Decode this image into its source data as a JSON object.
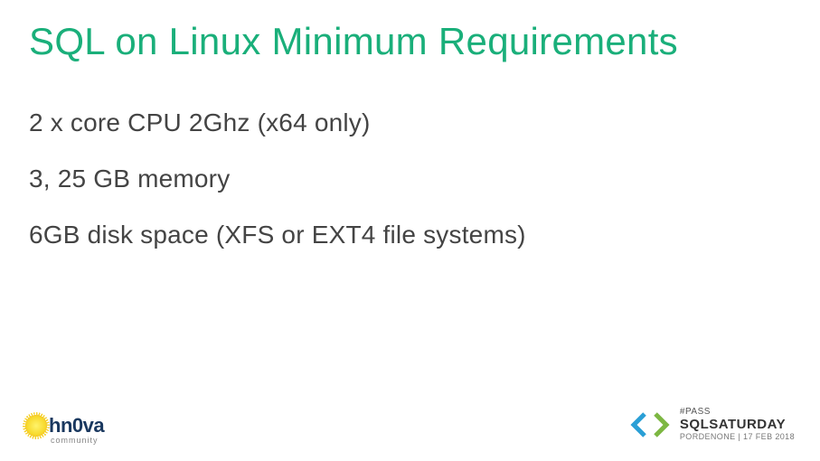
{
  "title": "SQL on Linux Minimum Requirements",
  "bullets": [
    "2 x core CPU 2Ghz (x64 only)",
    "3, 25 GB memory",
    "6GB disk space (XFS or EXT4 file systems)"
  ],
  "footer": {
    "left_logo": {
      "name": "hn0va",
      "subtitle": "community"
    },
    "right_logo": {
      "pass_label": "#PASS",
      "brand": "SQLSATURDAY",
      "event": "PORDENONE | 17 FEB 2018"
    }
  },
  "colors": {
    "title": "#1aaf7a",
    "chevron_left": "#2a9fd6",
    "chevron_right": "#7db742"
  }
}
